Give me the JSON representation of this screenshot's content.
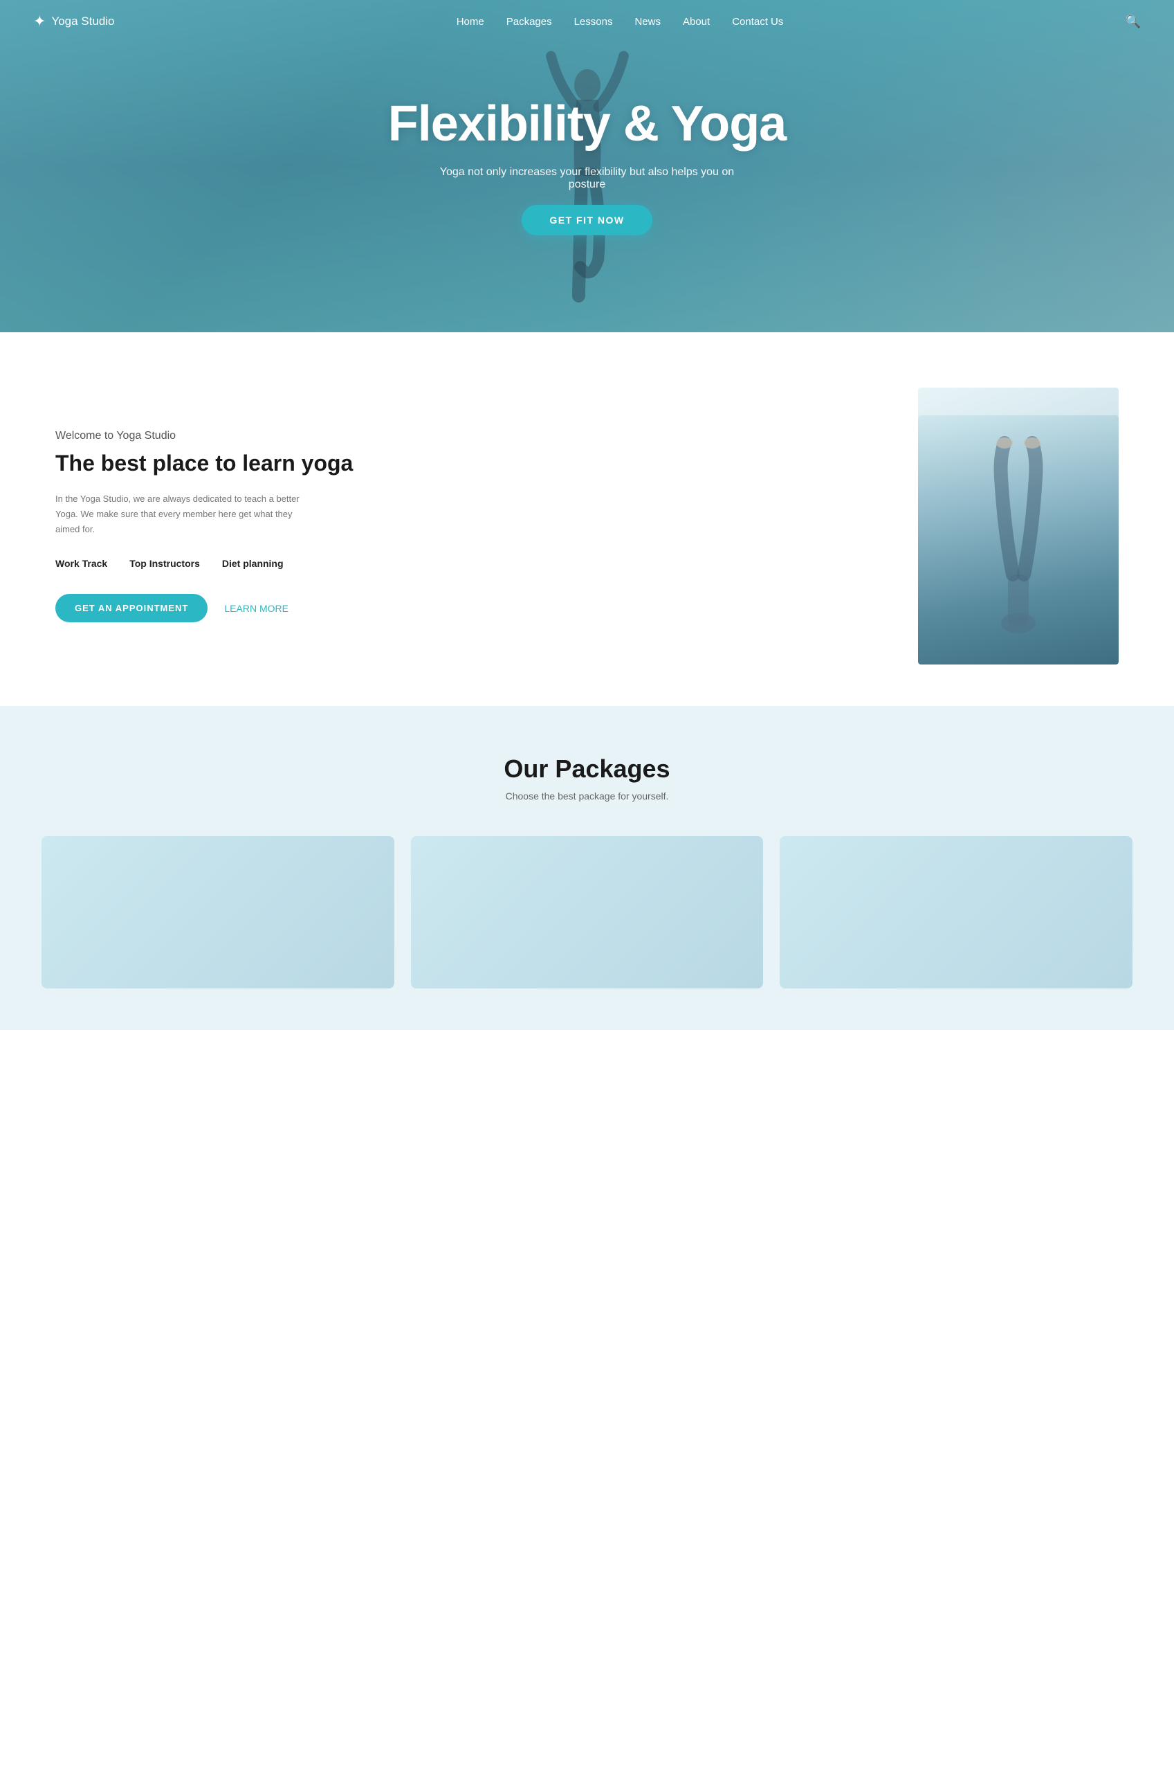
{
  "brand": {
    "name": "Yoga Studio",
    "logo_symbol": "🕉"
  },
  "nav": {
    "links": [
      {
        "label": "Home",
        "id": "home"
      },
      {
        "label": "Packages",
        "id": "packages"
      },
      {
        "label": "Lessons",
        "id": "lessons"
      },
      {
        "label": "News",
        "id": "news"
      },
      {
        "label": "About",
        "id": "about"
      },
      {
        "label": "Contact Us",
        "id": "contact"
      }
    ],
    "search_aria": "search"
  },
  "hero": {
    "title": "Flexibility & Yoga",
    "subtitle": "Yoga not only increases your flexibility but also helps you on posture",
    "cta_button": "GET FIT NOW"
  },
  "welcome": {
    "label": "Welcome to Yoga Studio",
    "heading": "The best place to learn yoga",
    "body": "In the Yoga Studio, we are always dedicated to teach a better Yoga. We make sure that every member  here get what they aimed for.",
    "features": [
      {
        "label": "Work Track",
        "id": "work-track"
      },
      {
        "label": "Top Instructors",
        "id": "top-instructors"
      },
      {
        "label": "Diet planning",
        "id": "diet-planning"
      }
    ],
    "btn_appointment": "GET AN APPOINTMENT",
    "btn_learn": "LEARN MORE"
  },
  "packages": {
    "title": "Our Packages",
    "subtitle": "Choose the best package for yourself.",
    "cards": [
      {
        "id": "package-1"
      },
      {
        "id": "package-2"
      },
      {
        "id": "package-3"
      }
    ]
  }
}
